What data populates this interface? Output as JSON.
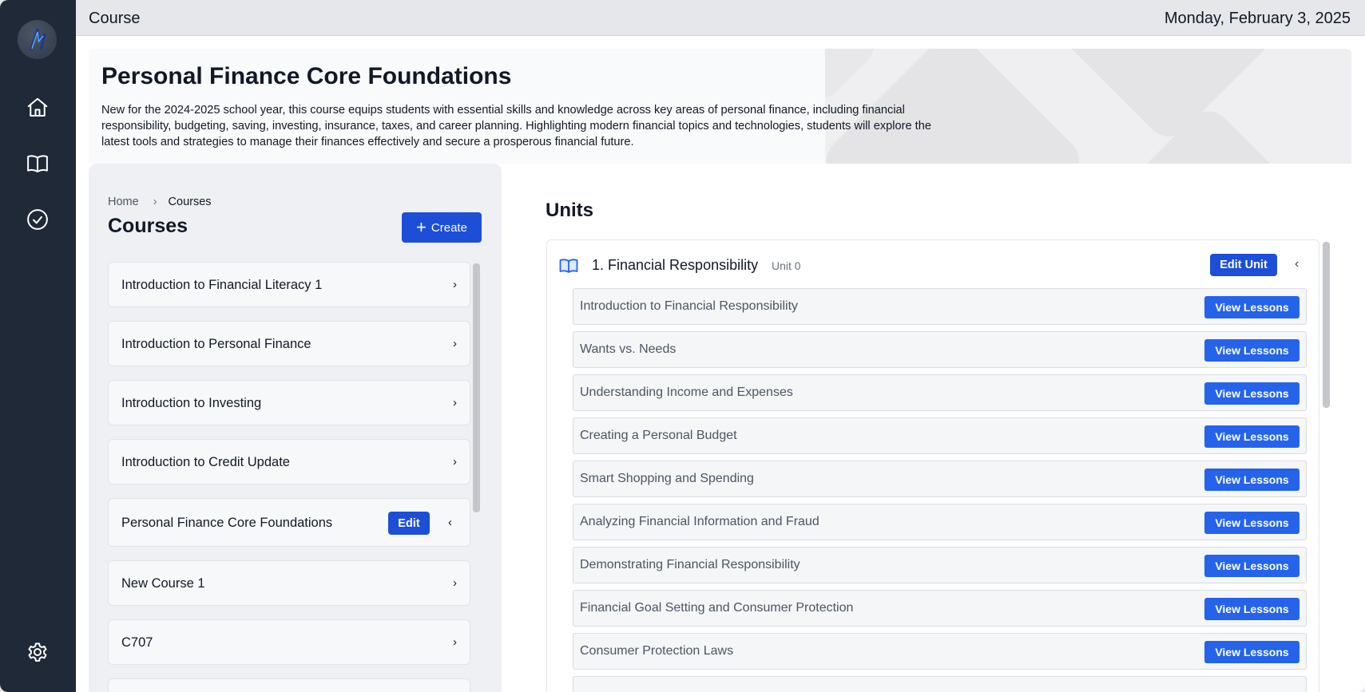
{
  "header": {
    "title": "Course",
    "date": "Monday, February 3, 2025"
  },
  "sidebar": {
    "icons": [
      "home-icon",
      "book-icon",
      "check-circle-icon",
      "settings-icon"
    ]
  },
  "hero": {
    "title": "Personal Finance Core Foundations",
    "description": "New for the 2024-2025 school year, this course equips students with essential skills and knowledge across key areas of personal finance, including financial responsibility, budgeting, saving, investing, insurance, taxes, and career planning. Highlighting modern financial topics and technologies, students will explore the latest tools and strategies to manage their finances effectively and secure a prosperous financial future."
  },
  "breadcrumb": {
    "home": "Home",
    "separator": "›",
    "current": "Courses"
  },
  "courses": {
    "title": "Courses",
    "create_label": "Create",
    "edit_label": "Edit",
    "items": [
      {
        "label": "Introduction to Financial Literacy 1"
      },
      {
        "label": "Introduction to Personal Finance"
      },
      {
        "label": "Introduction to Investing"
      },
      {
        "label": "Introduction to Credit Update"
      },
      {
        "label": "Personal Finance Core Foundations",
        "selected": true
      },
      {
        "label": "New Course 1"
      },
      {
        "label": "C707"
      }
    ]
  },
  "units": {
    "title": "Units",
    "unit": {
      "name": "1. Financial Responsibility",
      "sub": "Unit 0",
      "edit_label": "Edit Unit"
    },
    "view_label": "View Lessons",
    "lessons": [
      {
        "name": "Introduction to Financial Responsibility"
      },
      {
        "name": "Wants vs. Needs"
      },
      {
        "name": "Understanding Income and Expenses"
      },
      {
        "name": "Creating a Personal Budget"
      },
      {
        "name": "Smart Shopping and Spending"
      },
      {
        "name": "Analyzing Financial Information and Fraud"
      },
      {
        "name": "Demonstrating Financial Responsibility"
      },
      {
        "name": "Financial Goal Setting and Consumer Protection"
      },
      {
        "name": "Consumer Protection Laws"
      }
    ]
  },
  "colors": {
    "sidebar": "#1f2937",
    "primary": "#1d4ed8",
    "button": "#2563eb"
  }
}
